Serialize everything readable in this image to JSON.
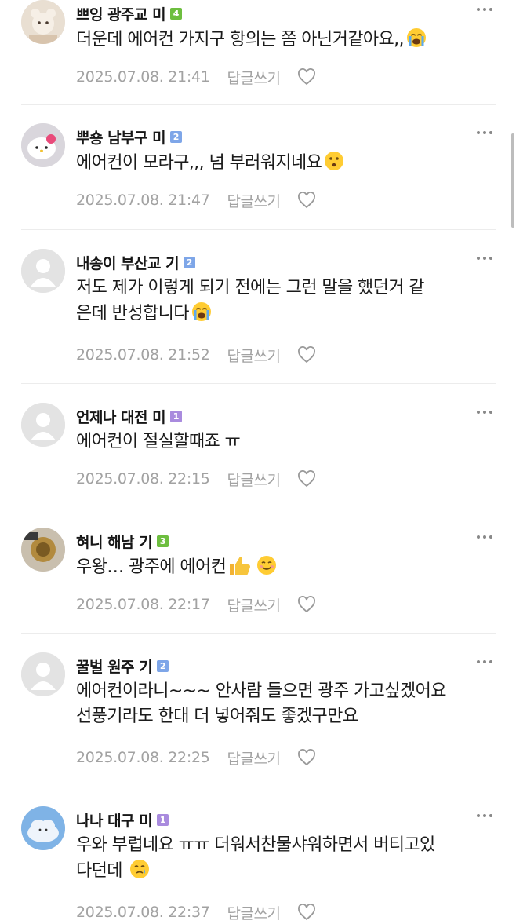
{
  "comments": [
    {
      "nickname": "쁘잉 광주교 미",
      "level": "4",
      "level_color": "#6dbe3f",
      "text_lines": [
        "더운데 에어컨 가지구 항의는 쫌 아닌거같아요,,"
      ],
      "emoji": "crying-face",
      "date": "2025.07.08. 21:41",
      "reply_label": "답글쓰기",
      "avatar": "bear"
    },
    {
      "nickname": "뿌숑 남부구 미",
      "level": "2",
      "level_color": "#7ea6e8",
      "text_lines": [
        "에어컨이 모라구,,, 넘 부러워지네요"
      ],
      "emoji": "kissing-face",
      "date": "2025.07.08. 21:47",
      "reply_label": "답글쓰기",
      "avatar": "kitty"
    },
    {
      "nickname": "내송이 부산교 기",
      "level": "2",
      "level_color": "#7ea6e8",
      "text_lines": [
        "저도 제가 이렇게 되기 전에는 그런 말을 했던거 같",
        "은데 반성합니다"
      ],
      "emoji": "crying-face",
      "date": "2025.07.08. 21:52",
      "reply_label": "답글쓰기",
      "avatar": "default"
    },
    {
      "nickname": "언제나 대전 미",
      "level": "1",
      "level_color": "#a98bde",
      "text_lines": [
        "에어컨이 절실할때죠 ㅠ"
      ],
      "emoji": "",
      "date": "2025.07.08. 22:15",
      "reply_label": "답글쓰기",
      "avatar": "default"
    },
    {
      "nickname": "혀니 해남 기",
      "level": "3",
      "level_color": "#6dbe3f",
      "text_lines": [
        "우왕… 광주에 에어컨"
      ],
      "emoji": "thumbs-up-smile",
      "date": "2025.07.08. 22:17",
      "reply_label": "답글쓰기",
      "avatar": "photo"
    },
    {
      "nickname": "꿀벌 원주 기",
      "level": "2",
      "level_color": "#7ea6e8",
      "text_lines": [
        "에어컨이라니~~~ 안사람 들으면 광주 가고싶겠어요",
        "선풍기라도 한대 더 넣어줘도 좋겠구만요"
      ],
      "emoji": "",
      "date": "2025.07.08. 22:25",
      "reply_label": "답글쓰기",
      "avatar": "default"
    },
    {
      "nickname": "나나 대구 미",
      "level": "1",
      "level_color": "#a98bde",
      "text_lines": [
        "우와 부럽네요 ㅠㅠ 더워서찬물샤워하면서 버티고있",
        "다던데"
      ],
      "emoji": "tear-smile",
      "date": "2025.07.08. 22:37",
      "reply_label": "답글쓰기",
      "avatar": "cloud"
    }
  ]
}
